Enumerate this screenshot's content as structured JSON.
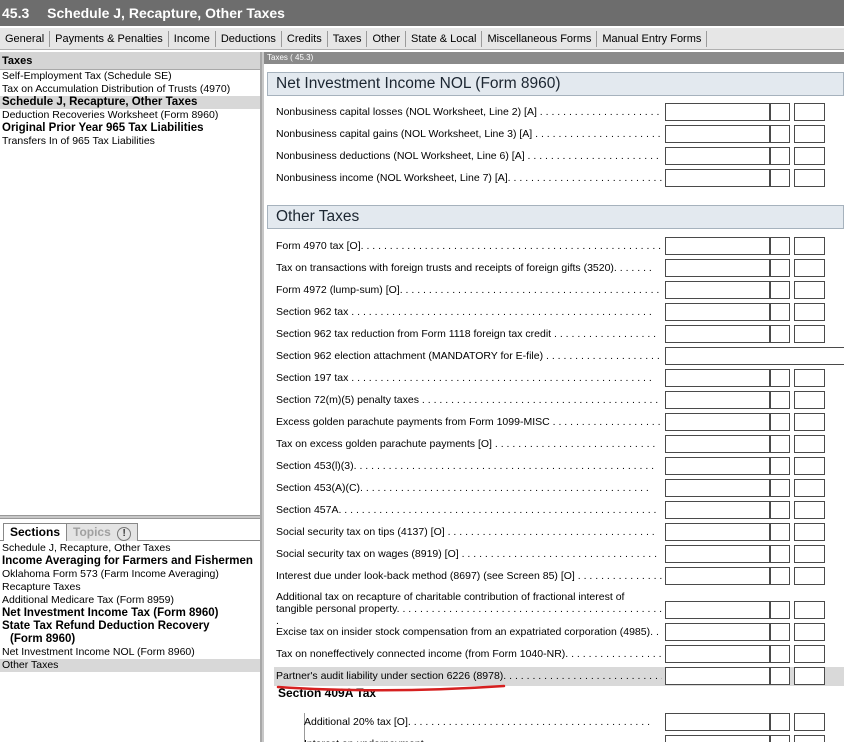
{
  "title": {
    "number": "45.3",
    "text": "Schedule J, Recapture, Other Taxes"
  },
  "tabs": [
    "General",
    "Payments & Penalties",
    "Income",
    "Deductions",
    "Credits",
    "Taxes",
    "Other",
    "State & Local",
    "Miscellaneous Forms",
    "Manual Entry Forms"
  ],
  "left": {
    "header": "Taxes",
    "items": [
      {
        "label": "Self-Employment Tax (Schedule SE)",
        "bold": false,
        "selected": false
      },
      {
        "label": "Tax on Accumulation Distribution of Trusts (4970)",
        "bold": false,
        "selected": false
      },
      {
        "label": "Schedule J, Recapture, Other Taxes",
        "bold": true,
        "selected": true
      },
      {
        "label": "Deduction Recoveries Worksheet (Form 8960)",
        "bold": false,
        "selected": false
      },
      {
        "label": "Original Prior Year 965 Tax Liabilities",
        "bold": true,
        "selected": false
      },
      {
        "label": "Transfers In of 965 Tax Liabilities",
        "bold": false,
        "selected": false
      }
    ]
  },
  "section_tabs": {
    "sections": "Sections",
    "topics": "Topics",
    "topics_icon": "!"
  },
  "sections": [
    {
      "label": "Schedule J, Recapture, Other Taxes",
      "bold": false,
      "selected": false
    },
    {
      "label": "Income Averaging for Farmers and Fishermen",
      "bold": true,
      "selected": false
    },
    {
      "label": "Oklahoma Form 573 (Farm Income Averaging)",
      "bold": false,
      "selected": false
    },
    {
      "label": "Recapture Taxes",
      "bold": false,
      "selected": false
    },
    {
      "label": "Additional Medicare Tax (Form 8959)",
      "bold": false,
      "selected": false
    },
    {
      "label": "Net Investment Income Tax (Form 8960)",
      "bold": true,
      "selected": false
    },
    {
      "label": "State Tax Refund Deduction Recovery",
      "bold": true,
      "selected": false
    },
    {
      "label": "  (Form 8960)",
      "bold": true,
      "selected": false
    },
    {
      "label": "Net Investment Income NOL (Form 8960)",
      "bold": false,
      "selected": false
    },
    {
      "label": "Other Taxes",
      "bold": false,
      "selected": true
    }
  ],
  "breadcrumb": "Taxes ( 45.3)",
  "groups": {
    "nol": "Net Investment Income NOL (Form 8960)",
    "other": "Other Taxes",
    "s409a": "Section 409A Tax"
  },
  "nol_rows": [
    "Nonbusiness capital losses (NOL Worksheet, Line 2) [A] . . . . . . . . . . . . . . . . . . . . . . .",
    "Nonbusiness capital gains (NOL Worksheet, Line 3) [A] . . . . . . . . . . . . . . . . . . . . . . .",
    "Nonbusiness deductions (NOL Worksheet, Line 6) [A] . . . . . . . . . . . . . . . . . . . . . . . . .",
    "Nonbusiness income (NOL Worksheet, Line 7) [A]. . . . . . . . . . . . . . . . . . . . . . . . . . . ."
  ],
  "other_rows": [
    {
      "label": "Form 4970 tax [O]. . . . . . . . . . . . . . . . . . . . . . . . . . . . . . . . . . . . . . . . . . . . . . . . . . . .",
      "type": "std"
    },
    {
      "label": "Tax on transactions with foreign trusts and receipts of foreign gifts (3520). . . . . . .",
      "type": "std"
    },
    {
      "label": "Form 4972 (lump-sum) [O]. . . . . . . . . . . . . . . . . . . . . . . . . . . . . . . . . . . . . . . . . . . . . .",
      "type": "std"
    },
    {
      "label": "Section 962 tax . . . . . . . . . . . . . . . . . . . . . . . . . . . . . . . . . . . . . . . . . . . . . . . . . . . .",
      "type": "std"
    },
    {
      "label": "Section 962 tax reduction from Form 1118 foreign tax credit . . . . . . . . . . . . . . . . . .",
      "type": "std"
    },
    {
      "label": "Section 962 election attachment (MANDATORY for E-file) . . . . . . . . . . . . . . . . . . . .",
      "type": "wide"
    },
    {
      "label": "Section 197 tax . . . . . . . . . . . . . . . . . . . . . . . . . . . . . . . . . . . . . . . . . . . . . . . . . . . .",
      "type": "std"
    },
    {
      "label": "Section 72(m)(5) penalty taxes . . . . . . . . . . . . . . . . . . . . . . . . . . . . . . . . . . . . . . . . .",
      "type": "std"
    },
    {
      "label": "Excess golden parachute payments from Form 1099-MISC . . . . . . . . . . . . . . . . . . .",
      "type": "std"
    },
    {
      "label": "Tax on excess golden parachute payments [O] . . . . . . . . . . . . . . . . . . . . . . . . . . . .",
      "type": "std"
    },
    {
      "label": "Section 453(l)(3). . . . . . . . . . . . . . . . . . . . . . . . . . . . . . . . . . . . . . . . . . . . . . . . . . . .",
      "type": "std"
    },
    {
      "label": "Section 453(A)(C). . . . . . . . . . . . . . . . . . . . . . . . . . . . . . . . . . . . . . . . . . . . . . . . . .",
      "type": "std"
    },
    {
      "label": "Section 457A. . . . . . . . . . . . . . . . . . . . . . . . . . . . . . . . . . . . . . . . . . . . . . . . . . . . . . .",
      "type": "std"
    },
    {
      "label": "Social security tax on tips (4137) [O] . . . . . . . . . . . . . . . . . . . . . . . . . . . . . . . . . . . .",
      "type": "std"
    },
    {
      "label": "Social security tax on wages (8919) [O] . . . . . . . . . . . . . . . . . . . . . . . . . . . . . . . . . .",
      "type": "std"
    },
    {
      "label": "Interest due under look-back method (8697) (see Screen 85) [O] . . . . . . . . . . . . . . .",
      "type": "std"
    },
    {
      "label": "Additional tax on recapture of charitable contribution of fractional interest of tangible personal property. . . . . . . . . . . . . . . . . . . . . . . . . . . . . . . . . . . . . . . . . . . . . . .",
      "type": "tall"
    },
    {
      "label": "Excise tax on insider stock compensation from an expatriated corporation (4985). . . .",
      "type": "std"
    },
    {
      "label": "Tax on noneffectively connected income (from Form 1040-NR). . . . . . . . . . . . . . . . .",
      "type": "std"
    },
    {
      "label": "Partner's audit liability under section 6226 (8978). . . . . . . . . . . . . . . . . . . . . . . . . . . .",
      "type": "doc",
      "highlight": true
    }
  ],
  "s409a_rows": [
    "Additional 20% tax [O]. . . . . . . . . . . . . . . . . . . . . . . . . . . . . . . . . . . . . . . . . .",
    "Interest on underpayment . . . . . . . . . . . . . . . . . . . . . . . . . . . . . . . . . . . . . . ."
  ],
  "annotation_color": "#d62020",
  "doc_icon": "document-icon"
}
